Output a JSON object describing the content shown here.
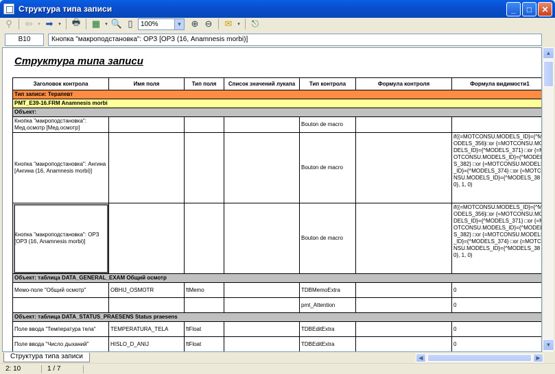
{
  "window": {
    "title": "Структура типа записи"
  },
  "toolbar": {
    "zoom": "100%",
    "icons": [
      "find-icon",
      "back-arrow-icon",
      "forward-arrow-icon",
      "print-icon",
      "excel-export-icon",
      "zoom-icon",
      "page-icon",
      "zoom-in-icon",
      "zoom-out-icon",
      "mail-icon",
      "exit-icon"
    ]
  },
  "cellbar": {
    "ref": "B10",
    "value": "Кнопка \"макроподстановка\": ОРЗ [ОРЗ (16, Anamnesis morbi)]"
  },
  "sheet": {
    "title": "Структура типа записи",
    "columns": [
      "Заголовок контрола",
      "Имя поля",
      "Тип поля",
      "Список значений лукапа",
      "Тип контрола",
      "Формула контроля",
      "Формула видимости1"
    ],
    "record_type": "Тип записи: Терапевт",
    "form_name": "PMT_E39-16.FRM Anamnesis morbi",
    "object_label": "Объект:",
    "rows1": [
      {
        "title": "Кнопка \"макроподстановка\": Мед.осмотр [Мед.осмотр]",
        "field": "",
        "ftype": "",
        "lookup": "",
        "ctype": "Bouton de macro",
        "fcontrol": "",
        "fvis": ""
      },
      {
        "title": "Кнопка \"макроподстановка\": Ангина [Ангина (16, Anamnesis morbi)]",
        "field": "",
        "ftype": "",
        "lookup": "",
        "ctype": "Bouton de macro",
        "fcontrol": "",
        "fvis": "if({=MOTCONSU.MODELS_ID}={^MODELS_356}□or {=MOTCONSU.MODELS_ID}={^MODELS_371} □or {=MOTCONSU.MODELS_ID}={^MODELS_382} □or {=MOTCONSU.MODELS_ID}={^MODELS_374} □or {=MOTCONSU.MODELS_ID}={^MODELS_380}, 1, 0)"
      },
      {
        "title": "Кнопка \"макроподстановка\": ОРЗ [ОРЗ (16, Anamnesis morbi)]",
        "field": "",
        "ftype": "",
        "lookup": "",
        "ctype": "Bouton de macro",
        "fcontrol": "",
        "fvis": "if({=MOTCONSU.MODELS_ID}={^MODELS_356}□or {=MOTCONSU.MODELS_ID}={^MODELS_371} □or {=MOTCONSU.MODELS_ID}={^MODELS_382} □or {=MOTCONSU.MODELS_ID}={^MODELS_374} □or {=MOTCONSU.MODELS_ID}={^MODELS_380}, 1, 0)"
      }
    ],
    "object2": "Объект: таблица DATA_GENERAL_EXAM Общий осмотр",
    "rows2": [
      {
        "title": "Мемо-поле \"Общий осмотр\"",
        "field": "OBHIJ_OSMOTR",
        "ftype": "ftMemo",
        "lookup": "",
        "ctype": "TDBMemoExtra",
        "fcontrol": "",
        "fvis": "0"
      },
      {
        "title": "",
        "field": "",
        "ftype": "",
        "lookup": "",
        "ctype": "pmt_Attention",
        "fcontrol": "",
        "fvis": "0"
      }
    ],
    "object3": "Объект: таблица DATA_STATUS_PRAESENS Status praesens",
    "rows3": [
      {
        "title": "Поле ввода \"Температура тела\"",
        "field": "TEMPERATURA_TELA",
        "ftype": "ftFloat",
        "lookup": "",
        "ctype": "TDBEditExtra",
        "fcontrol": "",
        "fvis": "0"
      },
      {
        "title": "Поле ввода \"Число дыханий\"",
        "field": "HISLO_D_ANIJ",
        "ftype": "ftFloat",
        "lookup": "",
        "ctype": "TDBEditExtra",
        "fcontrol": "",
        "fvis": "0"
      }
    ]
  },
  "tabs": {
    "sheet_tab": "Структура типа записи"
  },
  "status": {
    "position": "2: 10",
    "page": "1 / 7"
  }
}
